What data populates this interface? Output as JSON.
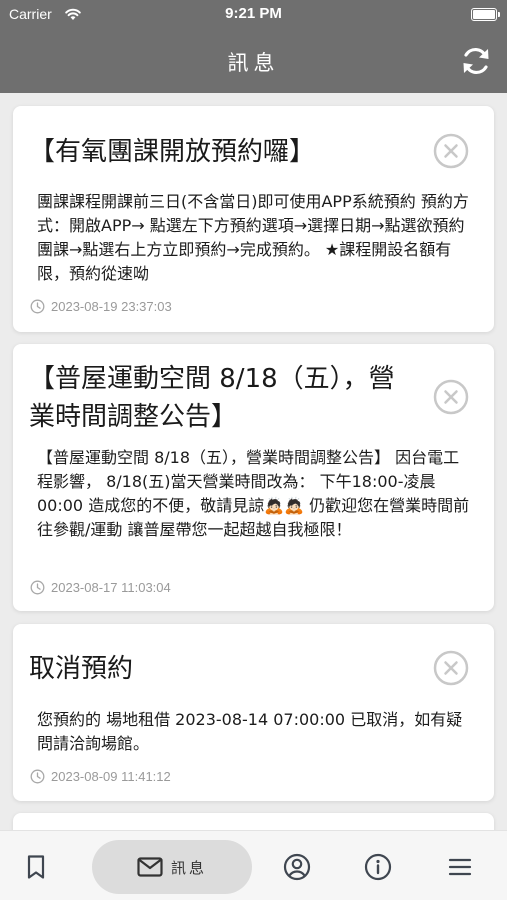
{
  "status_bar": {
    "carrier": "Carrier",
    "time": "9:21 PM"
  },
  "header": {
    "title": "訊息",
    "refresh_icon": "refresh-icon"
  },
  "messages": [
    {
      "title": "【有氧團課開放預約囉】",
      "body": "團課課程開課前三日(不含當日)即可使用APP系統預約 預約方式：開啟APP→ 點選左下方預約選項→選擇日期→點選欲預約團課→點選右上方立即預約→完成預約。 ★課程開設名額有限，預約從速呦",
      "timestamp": "2023-08-19 23:37:03"
    },
    {
      "title": "【普屋運動空間 8/18（五），營業時間調整公告】",
      "body": "【普屋運動空間 8/18（五），營業時間調整公告】 因台電工程影響， 8/18(五)當天營業時間改為： 下午18:00-凌晨00:00 造成您的不便，敬請見諒🙇🏻🙇🏻 仍歡迎您在營業時間前往參觀/運動 讓普屋帶您一起超越自我極限！",
      "timestamp": "2023-08-17 11:03:04"
    },
    {
      "title": "取消預約",
      "body": "您預約的 場地租借 2023-08-14 07:00:00 已取消，如有疑問請洽詢場館。",
      "timestamp": "2023-08-09 11:41:12"
    }
  ],
  "tab_bar": {
    "tabs": [
      {
        "icon": "bookmark-icon",
        "label": ""
      },
      {
        "icon": "mail-icon",
        "label": "訊息",
        "active": true
      },
      {
        "icon": "user-circle-icon",
        "label": ""
      },
      {
        "icon": "info-icon",
        "label": ""
      },
      {
        "icon": "menu-icon",
        "label": ""
      }
    ]
  },
  "colors": {
    "header_bg": "#6f6f6f",
    "page_bg": "#ececec",
    "card_bg": "#ffffff",
    "tab_active_bg": "#dcdcdc",
    "close_icon": "#c8c8c8",
    "timestamp": "#9a9a9a"
  }
}
